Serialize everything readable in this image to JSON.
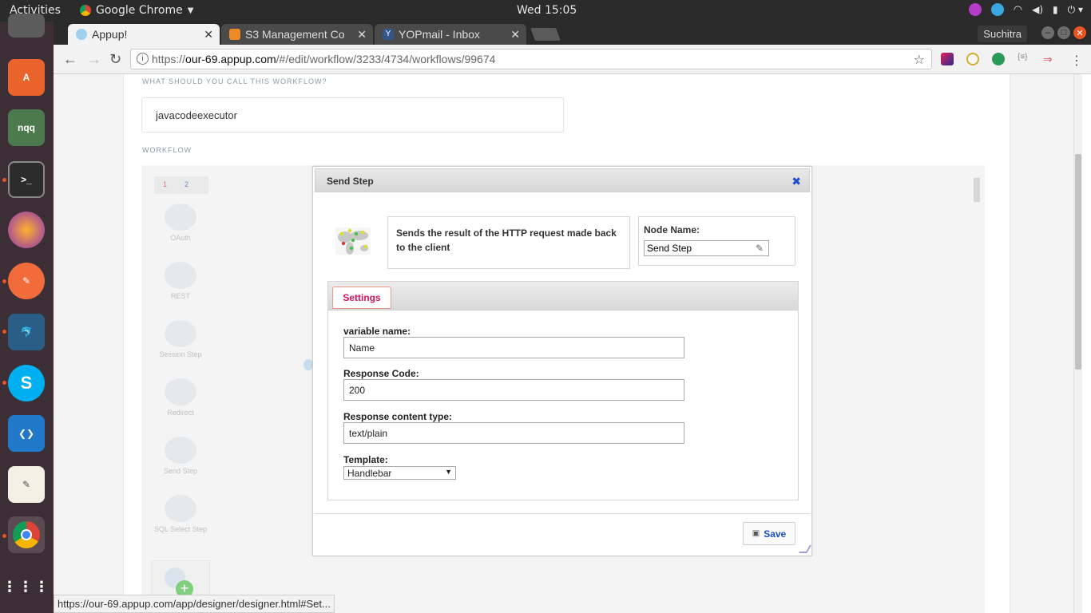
{
  "os": {
    "activities": "Activities",
    "app_menu": "Google Chrome",
    "clock": "Wed 15:05",
    "user": "Suchitra"
  },
  "browser": {
    "tabs": [
      {
        "title": "Appup!",
        "active": true
      },
      {
        "title": "S3 Management Co",
        "active": false
      },
      {
        "title": "YOPmail - Inbox",
        "active": false
      }
    ],
    "url_scheme": "https://",
    "url_host": "our-69.appup.com",
    "url_path": "/#/edit/workflow/3233/4734/workflows/99674",
    "status_url": "https://our-69.appup.com/app/designer/designer.html#Set..."
  },
  "page": {
    "name_label": "WHAT SHOULD YOU CALL THIS WORKFLOW?",
    "name_value": "javacodeexecutor",
    "workflow_label": "WORKFLOW",
    "palette_tabs": [
      "1",
      "2"
    ],
    "palette_items": [
      "OAuth",
      "REST",
      "Session Step",
      "Redirect",
      "Send Step",
      "SQL Select Step"
    ]
  },
  "dialog": {
    "title": "Send Step",
    "description": "Sends the result of the HTTP request made back to the client",
    "node_name_label": "Node Name:",
    "node_name_value": "Send Step",
    "tab_settings": "Settings",
    "fields": {
      "variable_name_label": "variable name:",
      "variable_name_value": "Name",
      "response_code_label": "Response Code:",
      "response_code_value": "200",
      "content_type_label": "Response content type:",
      "content_type_value": "text/plain",
      "template_label": "Template:",
      "template_value": "Handlebar"
    },
    "save_label": "Save"
  },
  "colors": {
    "accent_link": "#1a4fc9",
    "tab_active_text": "#d4145a",
    "ubuntu_orange": "#e95420"
  }
}
